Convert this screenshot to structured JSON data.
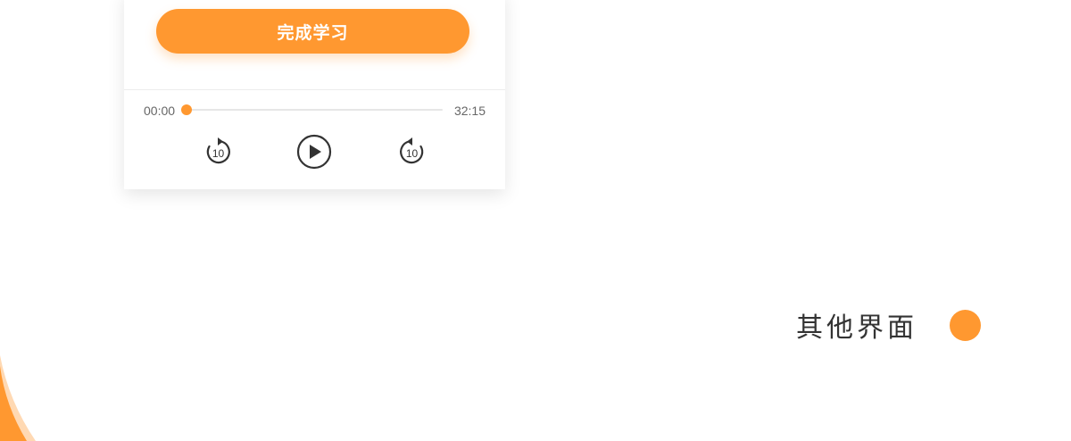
{
  "card": {
    "complete_button_label": "完成学习"
  },
  "player": {
    "current_time": "00:00",
    "total_time": "32:15",
    "progress": 0.0,
    "rewind_label": "10",
    "forward_label": "10"
  },
  "section": {
    "title": "其他界面"
  },
  "colors": {
    "accent": "#ff9830",
    "accent_light": "#ffd9b3",
    "text_dark": "#333333",
    "text_muted": "#666666"
  },
  "icons": {
    "rewind": "rewind-10-icon",
    "play": "play-icon",
    "forward": "forward-10-icon"
  }
}
